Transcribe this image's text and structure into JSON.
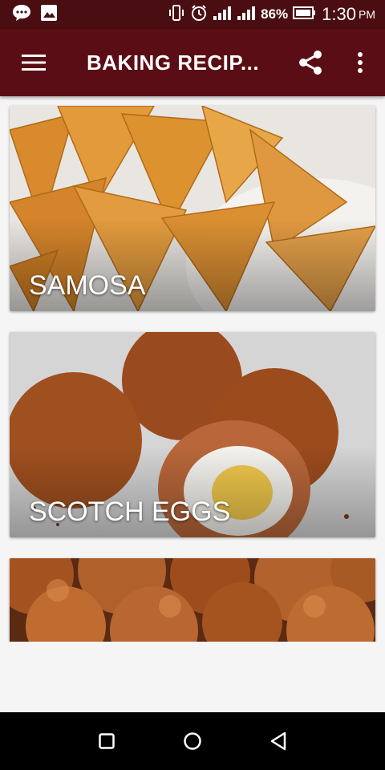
{
  "status_bar": {
    "battery": "86%",
    "time": "1:30",
    "ampm": "PM",
    "icons": [
      "chat-bubble-icon",
      "image-icon",
      "vibrate-icon",
      "alarm-icon",
      "signal-icon",
      "signal-icon",
      "battery-icon"
    ]
  },
  "app_bar": {
    "title": "BAKING RECIP...",
    "menu_icon": "hamburger-menu-icon",
    "share_icon": "share-icon",
    "more_icon": "more-vert-icon"
  },
  "recipes": [
    {
      "name": "SAMOSA"
    },
    {
      "name": "SCOTCH EGGS"
    },
    {
      "name": ""
    }
  ],
  "colors": {
    "app_bar": "#5a0d14",
    "status_bar": "#4a0e12",
    "background": "#f5f5f5"
  },
  "nav_bar": {
    "icons": [
      "recents-square-icon",
      "home-circle-icon",
      "back-triangle-icon"
    ]
  }
}
